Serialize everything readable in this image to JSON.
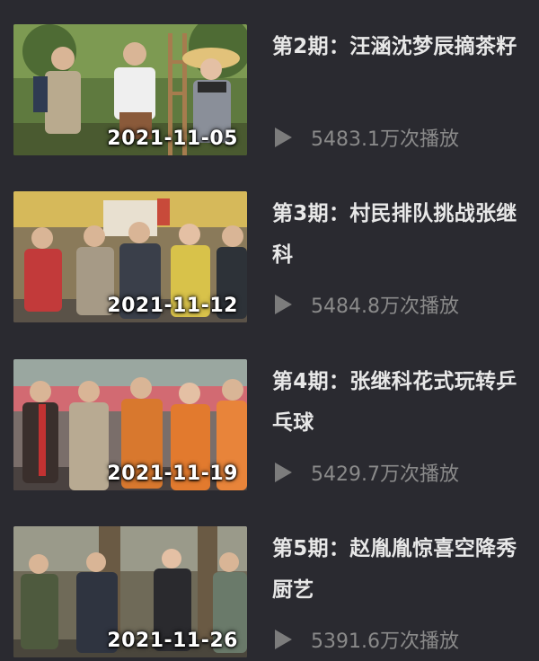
{
  "episodes": [
    {
      "title": "第2期：汪涵沈梦辰摘茶籽",
      "date": "2021-11-05",
      "plays": "5483.1万次播放",
      "colors": {
        "bg": "#6f8a4a",
        "accent": "#a9b96a",
        "floor": "#4f5f34"
      }
    },
    {
      "title": "第3期：村民排队挑战张继科",
      "date": "2021-11-12",
      "plays": "5484.8万次播放",
      "colors": {
        "bg": "#c9b05a",
        "accent": "#d9c97a",
        "floor": "#7a6a4a"
      }
    },
    {
      "title": "第4期：张继科花式玩转乒乓球",
      "date": "2021-11-19",
      "plays": "5429.7万次播放",
      "colors": {
        "bg": "#9b8a8a",
        "accent": "#c2685a",
        "floor": "#5a4f4a"
      }
    },
    {
      "title": "第5期：赵胤胤惊喜空降秀厨艺",
      "date": "2021-11-26",
      "plays": "5391.6万次播放",
      "colors": {
        "bg": "#8a7f6a",
        "accent": "#6e8a5a",
        "floor": "#4a4a3e"
      }
    }
  ]
}
